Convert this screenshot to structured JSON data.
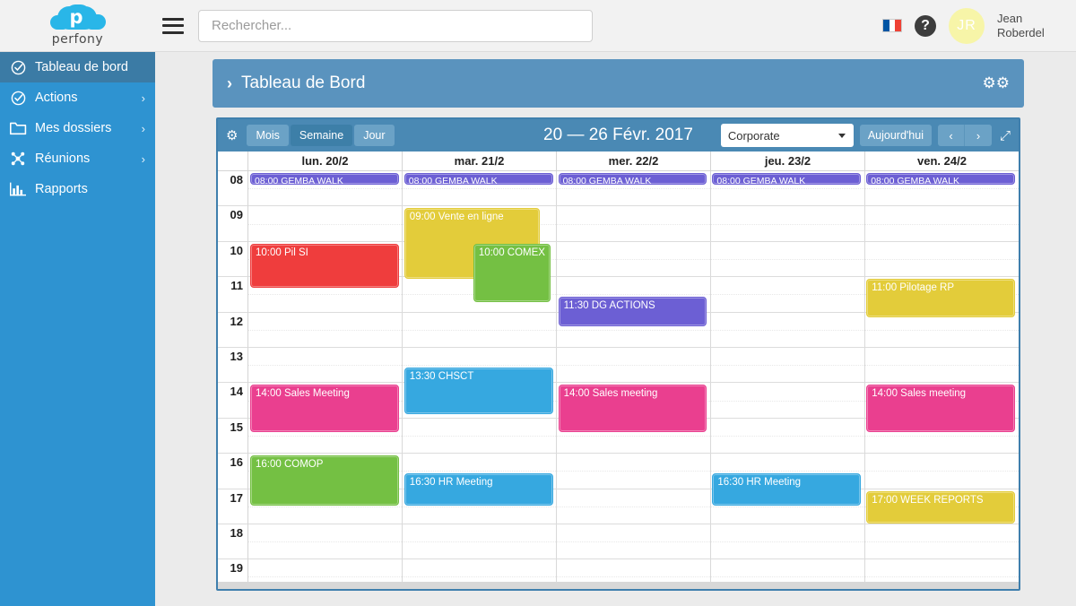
{
  "topbar": {
    "logo_text": "perfony",
    "logo_glyph": "p",
    "menu_icon": "hamburger-icon",
    "search": {
      "placeholder": "Rechercher...",
      "value": ""
    },
    "language_flag": "fr",
    "help_icon": "?",
    "avatar_initials": "JR",
    "user_first_name": "Jean",
    "user_last_name": "Roberdel"
  },
  "sidebar": {
    "items": [
      {
        "label": "Tableau de bord",
        "icon": "check-circle-icon",
        "active": true,
        "chevron": ""
      },
      {
        "label": "Actions",
        "icon": "check-circle-icon",
        "active": false,
        "chevron": "›"
      },
      {
        "label": "Mes dossiers",
        "icon": "folder-icon",
        "active": false,
        "chevron": "›"
      },
      {
        "label": "Réunions",
        "icon": "network-icon",
        "active": false,
        "chevron": "›"
      },
      {
        "label": "Rapports",
        "icon": "bar-chart-icon",
        "active": false,
        "chevron": ""
      }
    ]
  },
  "page_header": {
    "chevron": "›",
    "title": "Tableau de Bord",
    "settings_icon": "gears-icon"
  },
  "calendar": {
    "toolbar": {
      "gear_icon": "gear-icon",
      "views": [
        {
          "label": "Mois",
          "active": false
        },
        {
          "label": "Semaine",
          "active": true
        },
        {
          "label": "Jour",
          "active": false
        }
      ],
      "range_label": "20 — 26 Févr. 2017",
      "scope_selected": "Corporate",
      "today_label": "Aujourd'hui",
      "prev_label": "‹",
      "next_label": "›",
      "collapse_icon": "collapse-arrows-icon"
    },
    "days": [
      "lun. 20/2",
      "mar. 21/2",
      "mer. 22/2",
      "jeu. 23/2",
      "ven. 24/2"
    ],
    "hours": [
      "08",
      "09",
      "10",
      "11",
      "12",
      "13",
      "14",
      "15",
      "16",
      "17",
      "18",
      "19"
    ],
    "colors": {
      "purple": "#6c5fd4",
      "red": "#ef3d3d",
      "yellow": "#e3cc3a",
      "green": "#74c043",
      "blue": "#36a8e0",
      "pink": "#ea3f8f"
    },
    "events": [
      {
        "day": 0,
        "label": "08:00 GEMBA WALK",
        "start": "08:00",
        "end": "08:20",
        "color": "purple",
        "size": "small"
      },
      {
        "day": 1,
        "label": "08:00 GEMBA WALK",
        "start": "08:00",
        "end": "08:20",
        "color": "purple",
        "size": "small"
      },
      {
        "day": 2,
        "label": "08:00 GEMBA WALK",
        "start": "08:00",
        "end": "08:20",
        "color": "purple",
        "size": "small"
      },
      {
        "day": 3,
        "label": "08:00 GEMBA WALK",
        "start": "08:00",
        "end": "08:20",
        "color": "purple",
        "size": "small"
      },
      {
        "day": 4,
        "label": "08:00 GEMBA WALK",
        "start": "08:00",
        "end": "08:20",
        "color": "purple",
        "size": "small"
      },
      {
        "day": 0,
        "label": "10:00 Pil SI",
        "start": "10:00",
        "end": "11:15",
        "color": "red",
        "size": "big"
      },
      {
        "day": 1,
        "label": "09:00 Vente en ligne",
        "start": "09:00",
        "end": "11:00",
        "color": "yellow",
        "size": "big",
        "offset": "left"
      },
      {
        "day": 1,
        "label": "10:00 COMEX",
        "start": "10:00",
        "end": "11:40",
        "color": "green",
        "size": "big",
        "offset": "right"
      },
      {
        "day": 2,
        "label": "11:30 DG ACTIONS",
        "start": "11:30",
        "end": "12:20",
        "color": "purple",
        "size": "big"
      },
      {
        "day": 4,
        "label": "11:00 Pilotage RP",
        "start": "11:00",
        "end": "12:05",
        "color": "yellow",
        "size": "big"
      },
      {
        "day": 1,
        "label": "13:30 CHSCT",
        "start": "13:30",
        "end": "14:50",
        "color": "blue",
        "size": "big"
      },
      {
        "day": 0,
        "label": "14:00 Sales Meeting",
        "start": "14:00",
        "end": "15:20",
        "color": "pink",
        "size": "big"
      },
      {
        "day": 2,
        "label": "14:00 Sales meeting",
        "start": "14:00",
        "end": "15:20",
        "color": "pink",
        "size": "big"
      },
      {
        "day": 4,
        "label": "14:00 Sales meeting",
        "start": "14:00",
        "end": "15:20",
        "color": "pink",
        "size": "big"
      },
      {
        "day": 0,
        "label": "16:00 COMOP",
        "start": "16:00",
        "end": "17:25",
        "color": "green",
        "size": "big"
      },
      {
        "day": 1,
        "label": "16:30 HR Meeting",
        "start": "16:30",
        "end": "17:25",
        "color": "blue",
        "size": "big"
      },
      {
        "day": 3,
        "label": "16:30 HR Meeting",
        "start": "16:30",
        "end": "17:25",
        "color": "blue",
        "size": "big"
      },
      {
        "day": 4,
        "label": "17:00 WEEK REPORTS",
        "start": "17:00",
        "end": "17:55",
        "color": "yellow",
        "size": "big"
      }
    ]
  }
}
